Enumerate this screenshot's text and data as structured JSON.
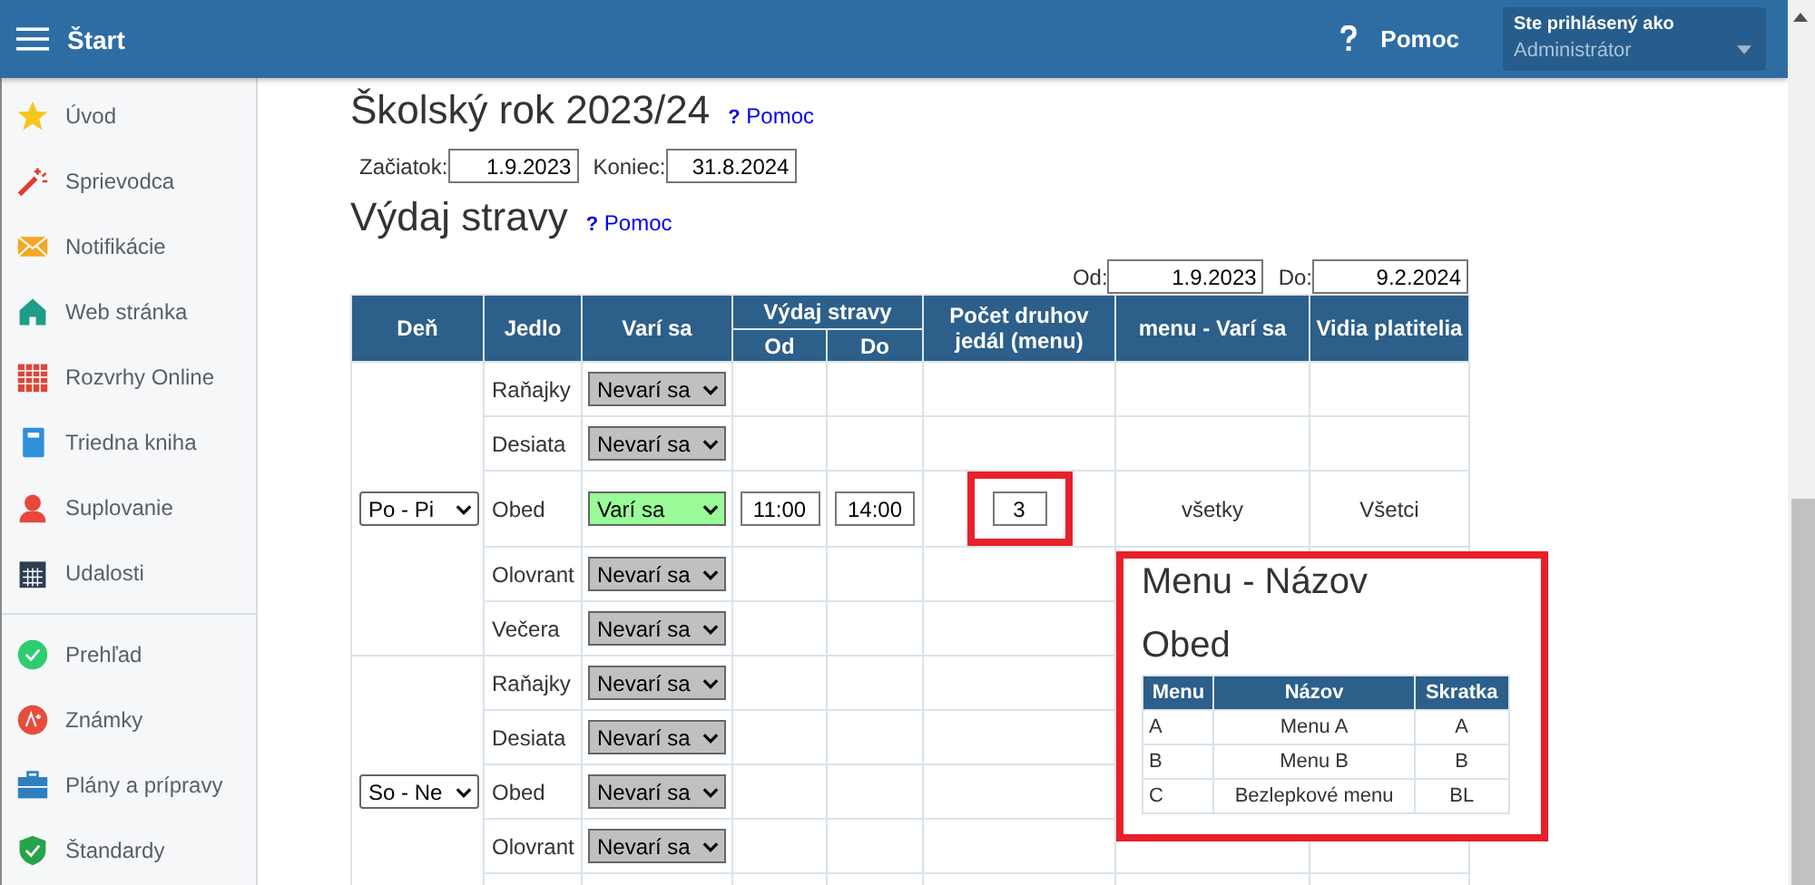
{
  "topbar": {
    "title": "Štart",
    "help": "Pomoc",
    "user_label": "Ste prihlásený ako",
    "user_name": "Administrátor"
  },
  "sidebar": {
    "groups": [
      [
        {
          "label": "Úvod"
        },
        {
          "label": "Sprievodca"
        },
        {
          "label": "Notifikácie"
        },
        {
          "label": "Web stránka"
        },
        {
          "label": "Rozvrhy Online"
        },
        {
          "label": "Triedna kniha"
        },
        {
          "label": "Suplovanie"
        },
        {
          "label": "Udalosti"
        }
      ],
      [
        {
          "label": "Prehľad"
        },
        {
          "label": "Známky"
        },
        {
          "label": "Plány a prípravy"
        },
        {
          "label": "Štandardy"
        }
      ]
    ]
  },
  "year": {
    "title": "Školský rok 2023/24",
    "help_mark": "?",
    "help": "Pomoc",
    "start_label": "Začiatok:",
    "start": "1.9.2023",
    "end_label": "Koniec:",
    "end": "31.8.2024"
  },
  "meals": {
    "title": "Výdaj stravy",
    "help_mark": "?",
    "help": "Pomoc",
    "from_label": "Od:",
    "from": "1.9.2023",
    "to_label": "Do:",
    "to": "9.2.2024",
    "columns": {
      "day": "Deň",
      "meal": "Jedlo",
      "cooking": "Varí sa",
      "serving": "Výdaj stravy",
      "serving_from": "Od",
      "serving_to": "Do",
      "count": "Počet druhov jedál (menu)",
      "menu_cooking": "menu - Varí sa",
      "visible_to": "Vidia platitelia"
    },
    "groups": [
      {
        "day": "Po - Pi",
        "rows": [
          {
            "meal": "Raňajky",
            "status": "Nevarí sa",
            "cooking": false
          },
          {
            "meal": "Desiata",
            "status": "Nevarí sa",
            "cooking": false
          },
          {
            "meal": "Obed",
            "status": "Varí sa",
            "cooking": true,
            "from": "11:00",
            "to": "14:00",
            "count": "3",
            "count_highlighted": true,
            "menu_cooking": "všetky",
            "visible_to": "Všetci"
          },
          {
            "meal": "Olovrant",
            "status": "Nevarí sa",
            "cooking": false
          },
          {
            "meal": "Večera",
            "status": "Nevarí sa",
            "cooking": false
          }
        ]
      },
      {
        "day": "So - Ne",
        "rows": [
          {
            "meal": "Raňajky",
            "status": "Nevarí sa",
            "cooking": false
          },
          {
            "meal": "Desiata",
            "status": "Nevarí sa",
            "cooking": false
          },
          {
            "meal": "Obed",
            "status": "Nevarí sa",
            "cooking": false
          },
          {
            "meal": "Olovrant",
            "status": "Nevarí sa",
            "cooking": false
          }
        ]
      }
    ]
  },
  "popup": {
    "title": "Menu - Názov",
    "subtitle": "Obed",
    "columns": [
      "Menu",
      "Názov",
      "Skratka"
    ],
    "rows": [
      [
        "A",
        "Menu A",
        "A"
      ],
      [
        "B",
        "Menu B",
        "B"
      ],
      [
        "C",
        "Bezlepkové menu",
        "BL"
      ]
    ]
  }
}
